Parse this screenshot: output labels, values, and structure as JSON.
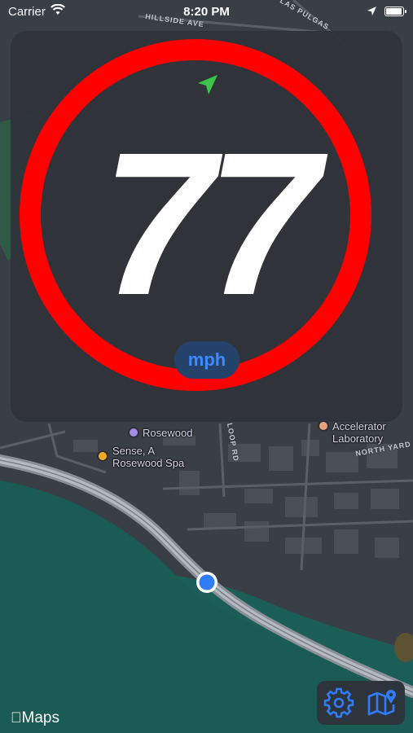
{
  "status_bar": {
    "carrier": "Carrier",
    "time": "8:20 PM",
    "battery_level": 1.0
  },
  "speed_display": {
    "speed": "77",
    "unit": "mph",
    "limit_ring_color": "#fe0000",
    "heading_arrow_color": "#3cc44a"
  },
  "map": {
    "road_labels": [
      "HILLSIDE AVE",
      "LAS PULGAS",
      "LOOP RD",
      "NORTH YARD"
    ],
    "pois": [
      {
        "name": "Rosewood",
        "icon": "hotel-icon",
        "color": "#a48be8"
      },
      {
        "name": "Sense, A\nRosewood Spa",
        "icon": "spa-icon",
        "color": "#f4a81d"
      },
      {
        "name": "Accelerator\nLaboratory",
        "icon": "landmark-icon",
        "color": "#e7a27a"
      }
    ],
    "attribution": "Maps"
  },
  "controls": {
    "settings_icon": "gear-icon",
    "map_icon": "map-pin-icon"
  }
}
